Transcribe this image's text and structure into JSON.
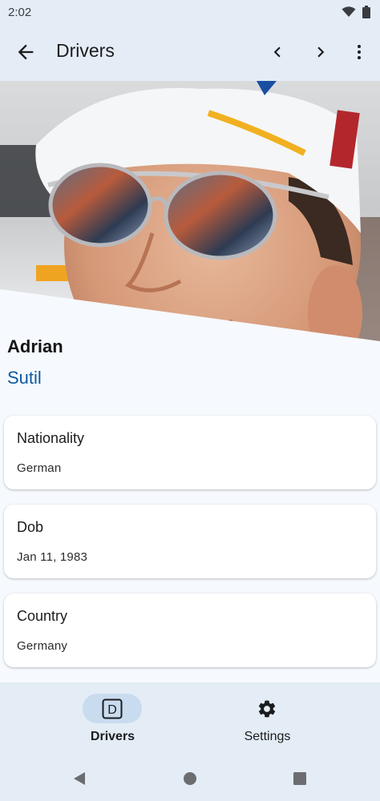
{
  "status_bar": {
    "time": "2:02",
    "icons": [
      "wifi-icon",
      "battery-icon"
    ]
  },
  "app_bar": {
    "title": "Drivers",
    "icons": [
      "back-arrow-icon",
      "chevron-left-icon",
      "chevron-right-icon",
      "more-vert-icon"
    ]
  },
  "driver": {
    "first_name": "Adrian",
    "last_name": "Sutil",
    "photo": "driver-photo"
  },
  "details": [
    {
      "label": "Nationality",
      "value": "German"
    },
    {
      "label": "Dob",
      "value": "Jan 11, 1983"
    },
    {
      "label": "Country",
      "value": "Germany"
    }
  ],
  "bottom_nav": {
    "items": [
      {
        "label": "Drivers",
        "icon": "drivers-d-icon",
        "selected": true
      },
      {
        "label": "Settings",
        "icon": "gear-icon",
        "selected": false
      }
    ]
  },
  "system_nav": {
    "icons": [
      "back-triangle-icon",
      "home-circle-icon",
      "recents-square-icon"
    ]
  },
  "colors": {
    "surface": "#e4edf6",
    "background": "#f6f9fd",
    "accent": "#0d5aa0",
    "nav_indicator": "#c9dcef",
    "system_bar": "#e4edf6"
  }
}
